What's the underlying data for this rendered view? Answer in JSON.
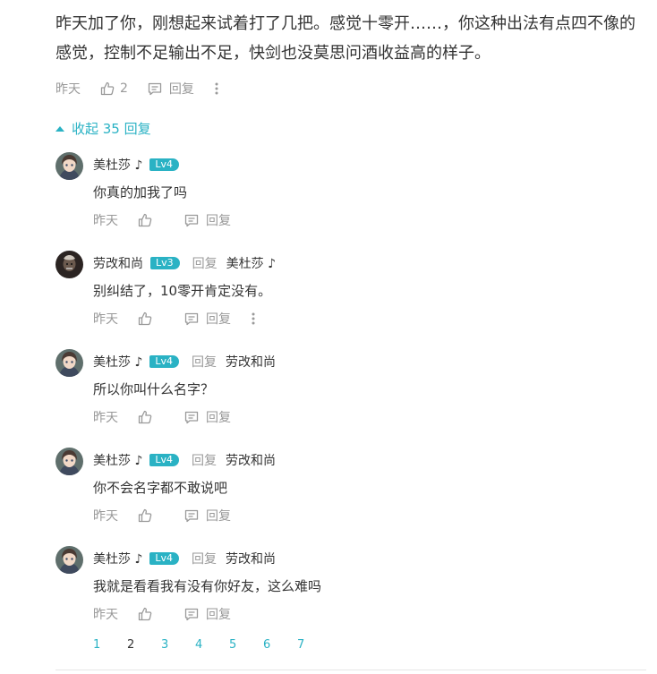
{
  "main_comment": {
    "text": "昨天加了你，刚想起来试着打了几把。感觉十零开……，你这种出法有点四不像的感觉，控制不足输出不足，快剑也没莫思问酒收益高的样子。",
    "time": "昨天",
    "likes": "2",
    "reply_label": "回复"
  },
  "collapse_label": "收起 35 回复",
  "replies": [
    {
      "user": "美杜莎 ♪",
      "level": "Lv4",
      "reply_label": "",
      "reply_to": "",
      "text": "你真的加我了吗",
      "time": "昨天",
      "action_reply": "回复"
    },
    {
      "user": "劳改和尚",
      "level": "Lv3",
      "reply_label": "回复",
      "reply_to": "美杜莎 ♪",
      "text": "别纠结了，10零开肯定没有。",
      "time": "昨天",
      "action_reply": "回复"
    },
    {
      "user": "美杜莎 ♪",
      "level": "Lv4",
      "reply_label": "回复",
      "reply_to": "劳改和尚",
      "text": "所以你叫什么名字？",
      "time": "昨天",
      "action_reply": "回复"
    },
    {
      "user": "美杜莎 ♪",
      "level": "Lv4",
      "reply_label": "回复",
      "reply_to": "劳改和尚",
      "text": "你不会名字都不敢说吧",
      "time": "昨天",
      "action_reply": "回复"
    },
    {
      "user": "美杜莎 ♪",
      "level": "Lv4",
      "reply_label": "回复",
      "reply_to": "劳改和尚",
      "text": "我就是看看我有没有你好友，这么难吗",
      "time": "昨天",
      "action_reply": "回复"
    }
  ],
  "pagination": {
    "pages": [
      "1",
      "2",
      "3",
      "4",
      "5",
      "6",
      "7"
    ],
    "current": "2"
  },
  "icons": {
    "like": "thumbs-up-icon",
    "reply": "comment-bubble-icon",
    "more": "more-vertical-icon",
    "collapse": "triangle-up-icon"
  },
  "colors": {
    "accent": "#2ab2c4",
    "text": "#333333",
    "muted": "#999999"
  }
}
